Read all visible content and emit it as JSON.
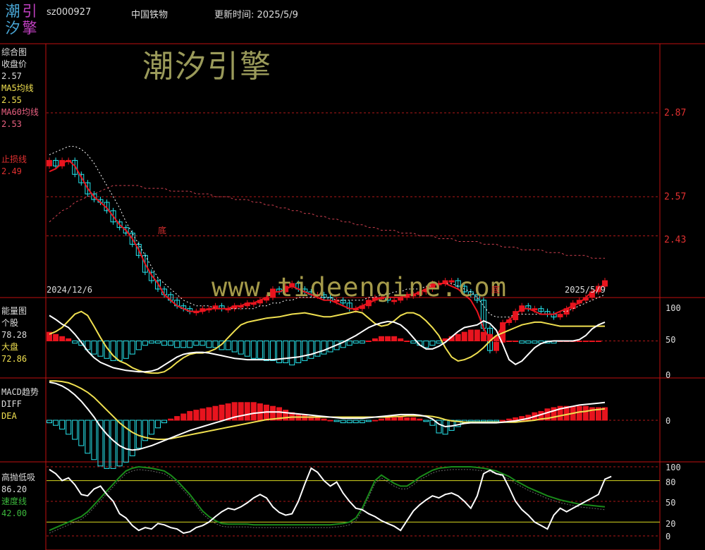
{
  "header": {
    "logo_chars": [
      "潮",
      "引",
      "汐",
      "擎"
    ],
    "code": "sz000927",
    "name": "中国铁物",
    "update_label": "更新时间:",
    "update_date": "2025/5/9"
  },
  "watermarks": {
    "cn": "潮汐引擎",
    "url": "www.tideengine.com"
  },
  "colors": {
    "up": "#e8141e",
    "down": "#27e6ee",
    "ma5": "#ffffff",
    "ma60": "#e8141e",
    "yellow": "#f0e050",
    "green": "#1a8a1a",
    "grid": "#b01818",
    "frame": "#c01010"
  },
  "panels": {
    "main": {
      "title": "综合图",
      "close_label": "收盘价",
      "close_value": "2.57",
      "ma5_label": "MA5均线",
      "ma5_value": "2.55",
      "ma60_label": "MA60均线",
      "ma60_value": "2.53",
      "stop_label": "止损线",
      "stop_value": "2.49",
      "date_start": "2024/12/6",
      "date_end": "2025/5/9",
      "bottom_marker": "底",
      "price_levels": [
        "2.87",
        "2.57",
        "2.43"
      ]
    },
    "energy": {
      "title": "能量图",
      "stock_label": "个股",
      "stock_value": "78.28",
      "market_label": "大盘",
      "market_value": "72.86",
      "ticks": [
        "100",
        "50",
        "0"
      ]
    },
    "macd": {
      "title": "MACD趋势",
      "diff_label": "DIFF",
      "dea_label": "DEA",
      "ticks": [
        "0"
      ]
    },
    "highlow": {
      "title": "高抛低吸",
      "value": "86.20",
      "speed_label": "速度线",
      "speed_value": "42.00",
      "ticks": [
        "100",
        "80",
        "50",
        "20",
        "0"
      ]
    }
  },
  "chart_data": [
    {
      "type": "candlestick",
      "title": "综合图",
      "x_range": [
        "2024/12/6",
        "2025/5/9"
      ],
      "price_axis": {
        "labeled_levels": [
          2.87,
          2.57,
          2.43
        ]
      },
      "close": [
        2.7,
        2.68,
        2.7,
        2.7,
        2.65,
        2.62,
        2.58,
        2.56,
        2.55,
        2.52,
        2.48,
        2.46,
        2.44,
        2.4,
        2.36,
        2.3,
        2.27,
        2.24,
        2.22,
        2.2,
        2.18,
        2.17,
        2.16,
        2.16,
        2.17,
        2.17,
        2.18,
        2.17,
        2.17,
        2.18,
        2.18,
        2.19,
        2.19,
        2.2,
        2.21,
        2.24,
        2.23,
        2.25,
        2.26,
        2.24,
        2.23,
        2.22,
        2.22,
        2.21,
        2.2,
        2.2,
        2.19,
        2.17,
        2.17,
        2.18,
        2.2,
        2.21,
        2.21,
        2.2,
        2.2,
        2.21,
        2.22,
        2.22,
        2.23,
        2.24,
        2.26,
        2.26,
        2.27,
        2.27,
        2.25,
        2.23,
        2.22,
        2.2,
        2.1,
        2.02,
        2.05,
        2.12,
        2.13,
        2.16,
        2.18,
        2.17,
        2.17,
        2.16,
        2.15,
        2.14,
        2.15,
        2.17,
        2.19,
        2.2,
        2.21,
        2.23,
        2.25,
        2.27
      ],
      "ma5": [
        2.66,
        2.67,
        2.69,
        2.7,
        2.68,
        2.64,
        2.6,
        2.57,
        2.55,
        2.53,
        2.5,
        2.47,
        2.45,
        2.42,
        2.38,
        2.33,
        2.29,
        2.26,
        2.22,
        2.2,
        2.18,
        2.17,
        2.16,
        2.16,
        2.16,
        2.17,
        2.17,
        2.17,
        2.17,
        2.18,
        2.18,
        2.19,
        2.19,
        2.2,
        2.21,
        2.23,
        2.23,
        2.24,
        2.25,
        2.24,
        2.23,
        2.22,
        2.21,
        2.2,
        2.2,
        2.19,
        2.18,
        2.17,
        2.17,
        2.18,
        2.19,
        2.2,
        2.21,
        2.21,
        2.21,
        2.21,
        2.22,
        2.22,
        2.23,
        2.24,
        2.25,
        2.26,
        2.26,
        2.25,
        2.24,
        2.22,
        2.2,
        2.16,
        2.1,
        2.06,
        2.07,
        2.11,
        2.13,
        2.15,
        2.17,
        2.17,
        2.16,
        2.15,
        2.15,
        2.15,
        2.16,
        2.17,
        2.18,
        2.19,
        2.21,
        2.23,
        2.24,
        2.26
      ],
      "ma60": [
        2.48,
        2.5,
        2.52,
        2.53,
        2.55,
        2.56,
        2.57,
        2.58,
        2.59,
        2.6,
        2.61,
        2.61,
        2.61,
        2.61,
        2.61,
        2.6,
        2.6,
        2.6,
        2.6,
        2.59,
        2.59,
        2.59,
        2.59,
        2.58,
        2.58,
        2.58,
        2.57,
        2.57,
        2.57,
        2.56,
        2.56,
        2.56,
        2.55,
        2.55,
        2.54,
        2.54,
        2.53,
        2.53,
        2.52,
        2.52,
        2.51,
        2.51,
        2.5,
        2.5,
        2.49,
        2.49,
        2.48,
        2.48,
        2.47,
        2.47,
        2.46,
        2.46,
        2.45,
        2.45,
        2.45,
        2.44,
        2.44,
        2.44,
        2.43,
        2.43,
        2.43,
        2.42,
        2.42,
        2.42,
        2.41,
        2.41,
        2.41,
        2.41,
        2.4,
        2.4,
        2.4,
        2.39,
        2.39,
        2.39,
        2.38,
        2.38,
        2.38,
        2.38,
        2.37,
        2.37,
        2.37,
        2.36,
        2.36,
        2.36,
        2.36,
        2.35,
        2.35,
        2.35
      ],
      "stop_line": [
        2.72,
        2.73,
        2.74,
        2.75,
        2.75,
        2.74,
        2.72,
        2.69,
        2.65,
        2.61,
        2.57,
        2.53,
        2.48,
        2.44,
        2.4,
        2.36,
        2.32,
        2.28,
        2.26,
        2.24,
        2.22,
        2.2,
        2.19,
        2.18,
        2.18,
        2.18,
        2.17,
        2.17,
        2.17,
        2.17,
        2.17,
        2.17,
        2.17,
        2.18,
        2.18,
        2.19,
        2.19,
        2.2,
        2.2,
        2.21,
        2.21,
        2.21,
        2.21,
        2.21,
        2.21,
        2.2,
        2.2,
        2.2,
        2.2,
        2.2,
        2.21,
        2.21,
        2.22,
        2.22,
        2.23,
        2.23,
        2.24,
        2.24,
        2.24,
        2.25,
        2.25,
        2.26,
        2.26,
        2.26,
        2.25,
        2.24,
        2.23,
        2.21,
        2.18,
        2.15,
        2.14,
        2.14,
        2.14,
        2.15,
        2.15,
        2.15,
        2.15,
        2.15,
        2.15,
        2.15,
        2.16,
        2.16,
        2.17,
        2.18,
        2.19,
        2.2,
        2.21,
        2.22
      ]
    },
    {
      "type": "bar+line",
      "title": "能量图",
      "ylim": [
        0,
        100
      ],
      "series": [
        {
          "name": "个股",
          "values": [
            88,
            82,
            75,
            70,
            60,
            48,
            35,
            25,
            18,
            14,
            10,
            8,
            6,
            5,
            4,
            4,
            5,
            8,
            14,
            20,
            26,
            30,
            32,
            33,
            33,
            32,
            30,
            28,
            26,
            24,
            23,
            22,
            22,
            22,
            22,
            22,
            23,
            24,
            25,
            26,
            28,
            30,
            33,
            36,
            40,
            44,
            48,
            53,
            58,
            64,
            70,
            74,
            77,
            79,
            78,
            74,
            66,
            55,
            44,
            38,
            38,
            42,
            48,
            56,
            64,
            70,
            72,
            74,
            80,
            76,
            66,
            45,
            22,
            15,
            20,
            30,
            40,
            46,
            49,
            50,
            50,
            50,
            50,
            52,
            58,
            68,
            74,
            78
          ]
        },
        {
          "name": "大盘",
          "values": [
            60,
            64,
            70,
            80,
            90,
            94,
            88,
            72,
            55,
            40,
            28,
            20,
            16,
            10,
            6,
            3,
            2,
            2,
            4,
            10,
            18,
            25,
            30,
            32,
            32,
            34,
            38,
            45,
            55,
            65,
            74,
            78,
            80,
            82,
            84,
            85,
            86,
            88,
            90,
            91,
            92,
            90,
            88,
            86,
            86,
            88,
            90,
            92,
            94,
            92,
            84,
            76,
            72,
            74,
            80,
            88,
            92,
            92,
            88,
            80,
            70,
            58,
            40,
            26,
            20,
            22,
            26,
            32,
            40,
            50,
            58,
            62,
            66,
            70,
            74,
            76,
            78,
            78,
            76,
            74,
            72,
            72,
            72,
            72,
            72,
            72,
            72,
            72
          ]
        }
      ],
      "bars": [
        4,
        3,
        2,
        1,
        -1,
        -2,
        -4,
        -6,
        -7,
        -8,
        -9,
        -9,
        -8,
        -6,
        -4,
        -2,
        -1,
        -1,
        -2,
        -2,
        -3,
        -3,
        -3,
        -2,
        -2,
        -3,
        -3,
        -4,
        -4,
        -5,
        -6,
        -7,
        -8,
        -8,
        -9,
        -9,
        -10,
        -10,
        -11,
        -10,
        -9,
        -8,
        -7,
        -6,
        -5,
        -4,
        -3,
        -2,
        -1,
        -1,
        0,
        1,
        2,
        2,
        2,
        1,
        0,
        -1,
        -2,
        -3,
        -2,
        -1,
        1,
        2,
        3,
        4,
        5,
        5,
        4,
        3,
        2,
        1,
        0,
        0,
        -1,
        -1,
        -1,
        -1,
        -1,
        -1,
        0,
        0,
        0,
        0,
        0,
        0,
        0
      ]
    },
    {
      "type": "bar+line",
      "title": "MACD趋势",
      "series": [
        {
          "name": "DIFF",
          "values": [
            0.06,
            0.058,
            0.054,
            0.048,
            0.04,
            0.03,
            0.018,
            0.005,
            -0.01,
            -0.022,
            -0.032,
            -0.04,
            -0.045,
            -0.047,
            -0.046,
            -0.043,
            -0.04,
            -0.036,
            -0.032,
            -0.028,
            -0.024,
            -0.02,
            -0.016,
            -0.013,
            -0.01,
            -0.007,
            -0.004,
            -0.001,
            0.002,
            0.005,
            0.007,
            0.009,
            0.011,
            0.012,
            0.013,
            0.013,
            0.013,
            0.012,
            0.011,
            0.01,
            0.009,
            0.008,
            0.007,
            0.006,
            0.005,
            0.004,
            0.003,
            0.003,
            0.003,
            0.003,
            0.004,
            0.005,
            0.006,
            0.007,
            0.008,
            0.009,
            0.009,
            0.009,
            0.008,
            0.006,
            0.002,
            -0.006,
            -0.01,
            -0.009,
            -0.007,
            -0.005,
            -0.004,
            -0.004,
            -0.004,
            -0.004,
            -0.004,
            -0.003,
            -0.002,
            -0.001,
            0.001,
            0.003,
            0.006,
            0.009,
            0.012,
            0.015,
            0.018,
            0.02,
            0.022,
            0.024,
            0.025,
            0.026,
            0.027,
            0.028
          ]
        },
        {
          "name": "DEA",
          "values": [
            0.062,
            0.062,
            0.061,
            0.059,
            0.055,
            0.05,
            0.044,
            0.036,
            0.026,
            0.016,
            0.006,
            -0.004,
            -0.012,
            -0.019,
            -0.024,
            -0.027,
            -0.029,
            -0.03,
            -0.03,
            -0.029,
            -0.027,
            -0.025,
            -0.023,
            -0.021,
            -0.019,
            -0.017,
            -0.015,
            -0.013,
            -0.011,
            -0.009,
            -0.007,
            -0.005,
            -0.003,
            -0.001,
            0.001,
            0.002,
            0.003,
            0.004,
            0.005,
            0.005,
            0.005,
            0.005,
            0.005,
            0.005,
            0.005,
            0.005,
            0.005,
            0.005,
            0.005,
            0.005,
            0.005,
            0.005,
            0.005,
            0.005,
            0.006,
            0.006,
            0.007,
            0.007,
            0.007,
            0.007,
            0.006,
            0.004,
            0.001,
            -0.001,
            -0.002,
            -0.003,
            -0.003,
            -0.003,
            -0.003,
            -0.003,
            -0.003,
            -0.003,
            -0.003,
            -0.003,
            -0.002,
            -0.001,
            0.0,
            0.002,
            0.003,
            0.005,
            0.007,
            0.009,
            0.011,
            0.013,
            0.014,
            0.016,
            0.017,
            0.018
          ]
        }
      ]
    },
    {
      "type": "line",
      "title": "高抛低吸",
      "ylim": [
        0,
        100
      ],
      "y_ticks": [
        0,
        20,
        50,
        80,
        100
      ],
      "series": [
        {
          "name": "高抛低吸",
          "values": [
            96,
            90,
            80,
            84,
            74,
            60,
            58,
            68,
            72,
            60,
            50,
            32,
            26,
            15,
            8,
            12,
            10,
            18,
            16,
            12,
            10,
            4,
            6,
            12,
            15,
            20,
            28,
            35,
            40,
            38,
            42,
            48,
            55,
            60,
            55,
            42,
            34,
            30,
            32,
            50,
            75,
            98,
            92,
            80,
            72,
            78,
            62,
            50,
            40,
            38,
            32,
            28,
            22,
            18,
            14,
            8,
            22,
            36,
            45,
            52,
            58,
            55,
            60,
            62,
            58,
            50,
            40,
            58,
            90,
            95,
            90,
            88,
            70,
            50,
            38,
            30,
            20,
            15,
            10,
            30,
            40,
            35,
            40,
            45,
            50,
            55,
            60,
            82,
            86
          ]
        },
        {
          "name": "速度线",
          "values": [
            8,
            12,
            16,
            20,
            24,
            28,
            35,
            45,
            55,
            65,
            75,
            85,
            94,
            98,
            100,
            99,
            98,
            96,
            94,
            88,
            80,
            70,
            60,
            48,
            36,
            28,
            22,
            18,
            17,
            17,
            17,
            17,
            16,
            16,
            16,
            16,
            16,
            16,
            16,
            16,
            16,
            16,
            16,
            16,
            16,
            17,
            18,
            20,
            26,
            40,
            60,
            80,
            88,
            82,
            76,
            72,
            72,
            78,
            85,
            90,
            95,
            98,
            99,
            100,
            100,
            100,
            100,
            99,
            98,
            96,
            94,
            90,
            86,
            80,
            75,
            70,
            66,
            62,
            58,
            55,
            52,
            50,
            48,
            46,
            45,
            44,
            43,
            42
          ]
        }
      ]
    }
  ]
}
